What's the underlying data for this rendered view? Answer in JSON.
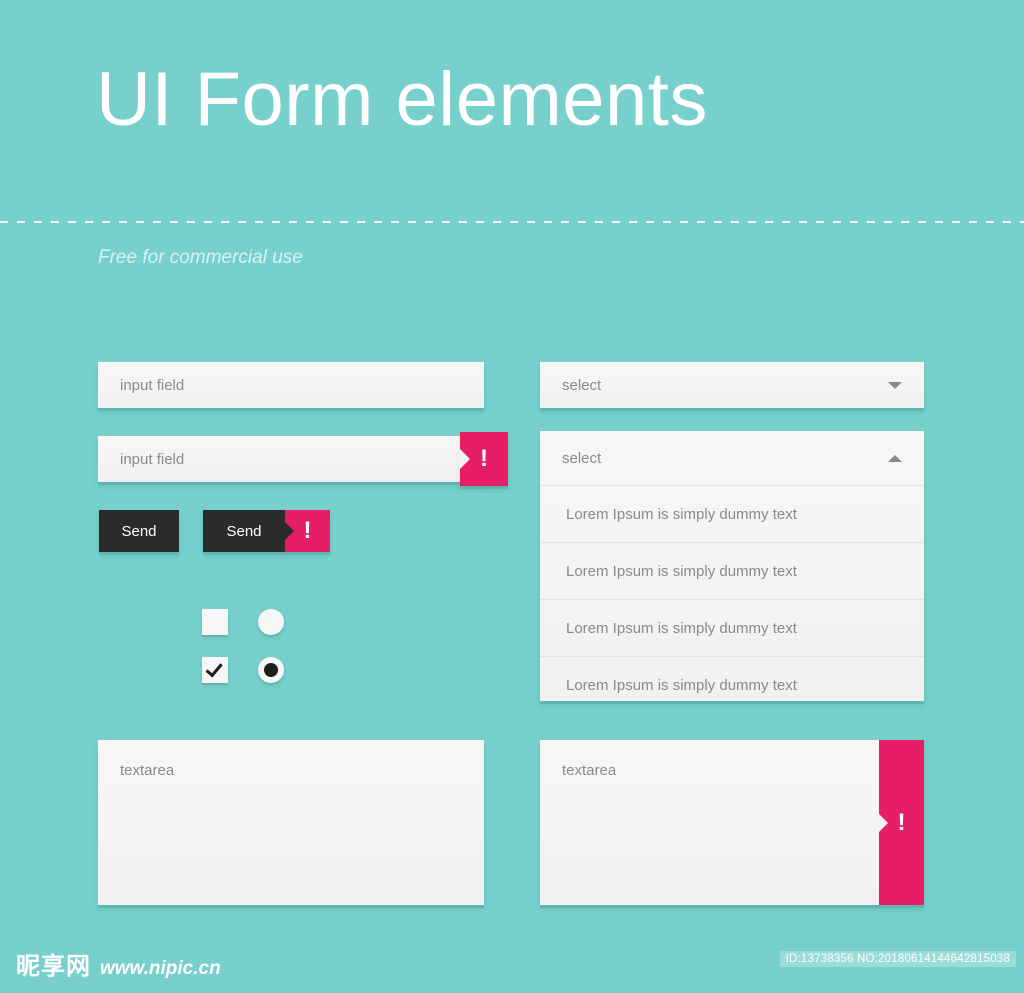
{
  "header": {
    "title": "UI Form elements",
    "subtitle": "Free for commercial use"
  },
  "colors": {
    "background": "#77D0CB",
    "field": "#F3F3F3",
    "error_pink": "#E61E65",
    "button_dark": "#2B2B2B",
    "text_gray": "#8A8A8A"
  },
  "left_column": {
    "input_normal": {
      "value": "input field",
      "placeholder": "input field"
    },
    "input_error": {
      "value": "input field",
      "placeholder": "input field",
      "error_symbol": "!"
    },
    "button_normal": {
      "label": "Send"
    },
    "button_error": {
      "label": "Send",
      "error_symbol": "!"
    },
    "choices": {
      "row_unchecked": {
        "checkbox_label": "",
        "radio_label": ""
      },
      "row_checked": {
        "checkbox_label": "",
        "radio_label": ""
      }
    },
    "textarea_normal": {
      "value": "textarea",
      "placeholder": "textarea"
    }
  },
  "right_column": {
    "select_collapsed": {
      "label": "select",
      "caret": "chevron-down"
    },
    "select_expanded": {
      "label": "select",
      "caret": "chevron-up",
      "options": [
        "Lorem Ipsum is simply dummy text",
        "Lorem Ipsum is simply dummy text",
        "Lorem Ipsum is simply dummy text",
        "Lorem Ipsum is simply dummy text"
      ]
    },
    "textarea_error": {
      "value": "textarea",
      "placeholder": "textarea",
      "error_symbol": "!"
    }
  },
  "watermark": {
    "logo": "昵享网",
    "url": "www.nipic.cn",
    "id_text": "ID:13738356 NO:20180614144642815038"
  }
}
